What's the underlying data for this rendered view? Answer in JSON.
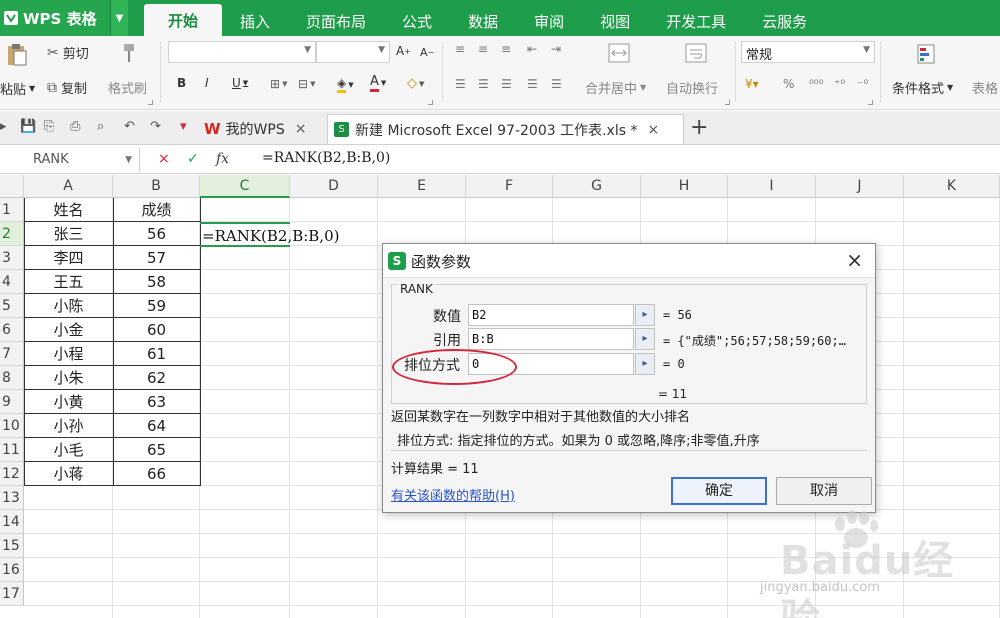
{
  "app": {
    "brand": "WPS 表格",
    "brand_logo_glyph": "W"
  },
  "menu": {
    "tabs": [
      "开始",
      "插入",
      "页面布局",
      "公式",
      "数据",
      "审阅",
      "视图",
      "开发工具",
      "云服务"
    ],
    "active": 0
  },
  "ribbon": {
    "paste": "粘贴",
    "cut": "剪切",
    "copy": "复制",
    "format_painter": "格式刷",
    "merge_center": "合并居中",
    "wrap_text": "自动换行",
    "number_format": "常规",
    "conditional_format": "条件格式",
    "table_style": "表格",
    "bold": "B",
    "italic": "I",
    "underline": "U",
    "font_color": "A",
    "percent": "%",
    "font_grow": "A",
    "font_shrink": "A"
  },
  "tabs": [
    {
      "label": "我的WPS",
      "close": "×"
    },
    {
      "label": "新建 Microsoft Excel 97-2003 工作表.xls *",
      "close": "×"
    }
  ],
  "new_tab": "+",
  "formula_bar": {
    "name_box": "RANK",
    "cancel": "×",
    "confirm": "✓",
    "fx": "fx",
    "formula": "=RANK(B2,B:B,0)"
  },
  "sheet": {
    "columns": [
      "A",
      "B",
      "C",
      "D",
      "E",
      "F",
      "G",
      "H",
      "I",
      "J",
      "K"
    ],
    "selected_column": "C",
    "rows": [
      "1",
      "2",
      "3",
      "4",
      "5",
      "6",
      "7",
      "8",
      "9",
      "10",
      "11",
      "12",
      "13",
      "14",
      "15",
      "16",
      "17"
    ],
    "selected_row": "2",
    "header": {
      "a": "姓名",
      "b": "成绩"
    },
    "records": [
      {
        "name": "张三",
        "score": "56"
      },
      {
        "name": "李四",
        "score": "57"
      },
      {
        "name": "王五",
        "score": "58"
      },
      {
        "name": "小陈",
        "score": "59"
      },
      {
        "name": "小金",
        "score": "60"
      },
      {
        "name": "小程",
        "score": "61"
      },
      {
        "name": "小朱",
        "score": "62"
      },
      {
        "name": "小黄",
        "score": "63"
      },
      {
        "name": "小孙",
        "score": "64"
      },
      {
        "name": "小毛",
        "score": "65"
      },
      {
        "name": "小蒋",
        "score": "66"
      }
    ],
    "editing_text": "=RANK(B2,B:B,0)"
  },
  "dialog": {
    "icon": "S",
    "title": "函数参数",
    "close": "×",
    "function_name": "RANK",
    "args": [
      {
        "label": "数值",
        "value": "B2",
        "result": "= 56"
      },
      {
        "label": "引用",
        "value": "B:B",
        "result": "= {\"成绩\";56;57;58;59;60;…"
      },
      {
        "label": "排位方式",
        "value": "0",
        "result": "= 0"
      }
    ],
    "ref_button": "▸",
    "function_result": "= 11",
    "description": "返回某数字在一列数字中相对于其他数值的大小排名",
    "param_description": "排位方式: 指定排位的方式。如果为 0 或忽略,降序;非零值,升序",
    "calc_result": "计算结果 = 11",
    "help_link": "有关该函数的帮助(H)",
    "ok": "确定",
    "cancel": "取消"
  },
  "watermark": {
    "text": "Baidu经验",
    "sub": "jingyan.baidu.com"
  },
  "colors": {
    "brand": "#1e9e4a",
    "selection": "#2a9a4c",
    "annotation": "#d5263a",
    "link": "#2a55c8"
  }
}
